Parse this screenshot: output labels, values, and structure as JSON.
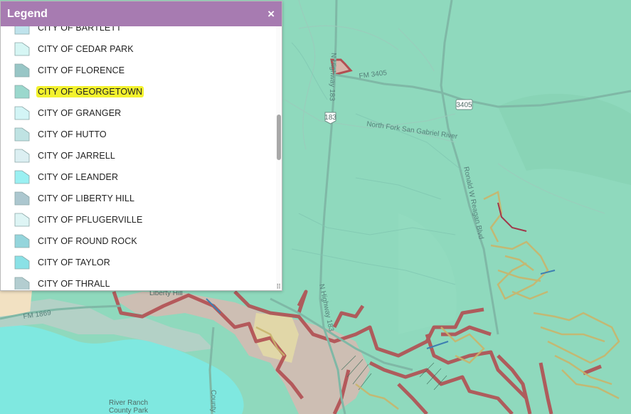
{
  "legend": {
    "title": "Legend",
    "close_glyph": "×",
    "items": [
      {
        "label": "CITY OF BARTLETT",
        "color": "#bfe3ec"
      },
      {
        "label": "CITY OF CEDAR PARK",
        "color": "#d6f6f4"
      },
      {
        "label": "CITY OF FLORENCE",
        "color": "#98c6c6"
      },
      {
        "label": "CITY OF GEORGETOWN",
        "color": "#9bd8cd",
        "highlighted": true
      },
      {
        "label": "CITY OF GRANGER",
        "color": "#d3f5f6"
      },
      {
        "label": "CITY OF HUTTO",
        "color": "#bfe3e3"
      },
      {
        "label": "CITY OF JARRELL",
        "color": "#dceff2"
      },
      {
        "label": "CITY OF LEANDER",
        "color": "#9af0f2"
      },
      {
        "label": "CITY OF LIBERTY HILL",
        "color": "#acc7cf"
      },
      {
        "label": "CITY OF PFLUGERVILLE",
        "color": "#def5f5"
      },
      {
        "label": "CITY OF ROUND ROCK",
        "color": "#94d5dc"
      },
      {
        "label": "CITY OF TAYLOR",
        "color": "#8ae1e6"
      },
      {
        "label": "CITY OF THRALL",
        "color": "#b3cdd0"
      }
    ],
    "highlight_color": "#f3f22d"
  },
  "map": {
    "labels": {
      "fm3405": "FM 3405",
      "shield_3405": "3405",
      "shield_183": "183",
      "north_fork": "North Fork San Gabriel River",
      "highway_183_upper": "N Highway 183",
      "highway_183_lower": "N Highway 183",
      "reagan": "Ronald W Reagan Blvd",
      "fm1869": "FM 1869",
      "liberty_hill": "Liberty Hill",
      "river_ranch": "River Ranch",
      "county_park": "County Park",
      "county_road": "County"
    }
  }
}
